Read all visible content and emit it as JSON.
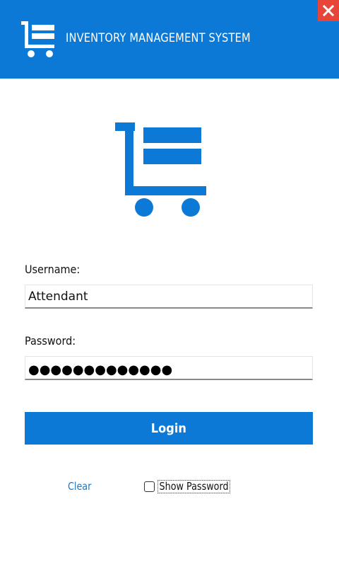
{
  "window": {
    "title": "INVENTORY MANAGEMENT SYSTEM",
    "close_icon": "close-icon"
  },
  "logo": {
    "icon": "shopping-cart-list-icon"
  },
  "form": {
    "username_label": "Username:",
    "username_value": "Attendant",
    "password_label": "Password:",
    "password_masked": "●●●●●●●●●●●●●",
    "login_label": "Login",
    "clear_label": "Clear",
    "show_password_label": "Show Password"
  },
  "colors": {
    "brand_blue": "#0b79d5",
    "close_red": "#e8453a",
    "link_blue": "#1778c8"
  }
}
